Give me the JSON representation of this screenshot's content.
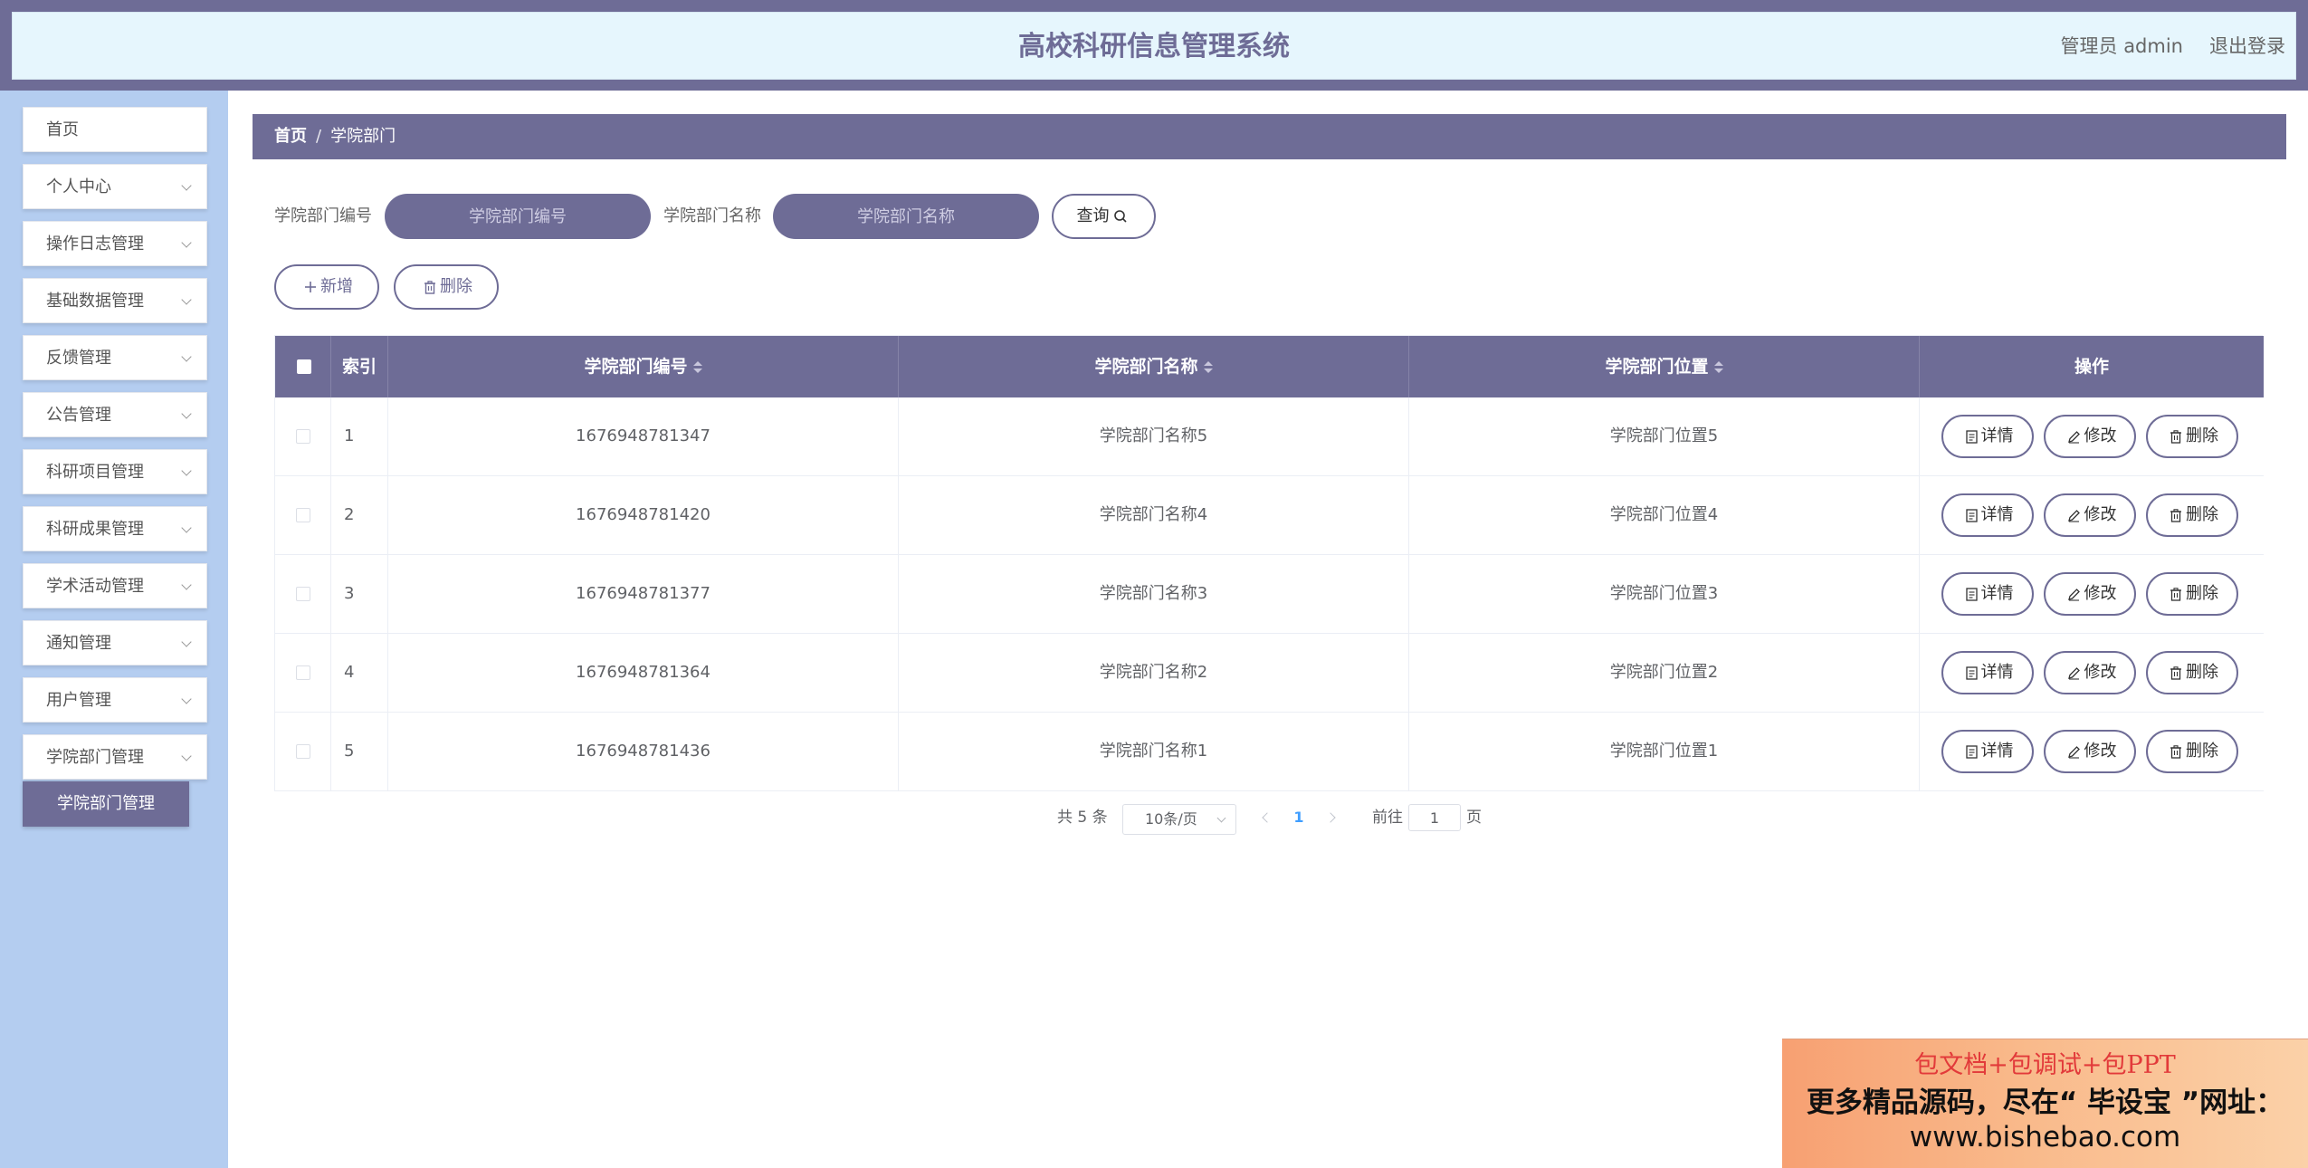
{
  "header": {
    "title": "高校科研信息管理系统",
    "user": "管理员 admin",
    "logout": "退出登录"
  },
  "sidebar": {
    "items": [
      {
        "label": "首页"
      },
      {
        "label": "个人中心"
      },
      {
        "label": "操作日志管理"
      },
      {
        "label": "基础数据管理"
      },
      {
        "label": "反馈管理"
      },
      {
        "label": "公告管理"
      },
      {
        "label": "科研项目管理"
      },
      {
        "label": "科研成果管理"
      },
      {
        "label": "学术活动管理"
      },
      {
        "label": "通知管理"
      },
      {
        "label": "用户管理"
      },
      {
        "label": "学院部门管理"
      }
    ],
    "active_sub": "学院部门管理"
  },
  "breadcrumb": {
    "home": "首页",
    "separator": "/",
    "current": "学院部门"
  },
  "search": {
    "code_label": "学院部门编号",
    "code_placeholder": "学院部门编号",
    "name_label": "学院部门名称",
    "name_placeholder": "学院部门名称",
    "query_button": "查询"
  },
  "actions": {
    "add": "新增",
    "delete": "删除"
  },
  "table": {
    "columns": [
      "索引",
      "学院部门编号",
      "学院部门名称",
      "学院部门位置",
      "操作"
    ],
    "rows": [
      {
        "index": "1",
        "code": "1676948781347",
        "name": "学院部门名称5",
        "location": "学院部门位置5"
      },
      {
        "index": "2",
        "code": "1676948781420",
        "name": "学院部门名称4",
        "location": "学院部门位置4"
      },
      {
        "index": "3",
        "code": "1676948781377",
        "name": "学院部门名称3",
        "location": "学院部门位置3"
      },
      {
        "index": "4",
        "code": "1676948781364",
        "name": "学院部门名称2",
        "location": "学院部门位置2"
      },
      {
        "index": "5",
        "code": "1676948781436",
        "name": "学院部门名称1",
        "location": "学院部门位置1"
      }
    ],
    "row_actions": {
      "detail": "详情",
      "edit": "修改",
      "delete": "删除"
    }
  },
  "pagination": {
    "total": "共 5 条",
    "page_size": "10条/页",
    "current_page": "1",
    "goto_label": "前往",
    "goto_value": "1",
    "page_suffix": "页"
  },
  "ad": {
    "line1": "包文档+包调试+包PPT",
    "line2": "更多精品源码，尽在“ 毕设宝 ”网址：",
    "line3": "www.bishebao.com"
  },
  "colors": {
    "accent": "#6e6c96",
    "sidebar_bg": "#b4cdf0",
    "header_bg": "#e6f6fd",
    "active_page": "#409eff"
  }
}
